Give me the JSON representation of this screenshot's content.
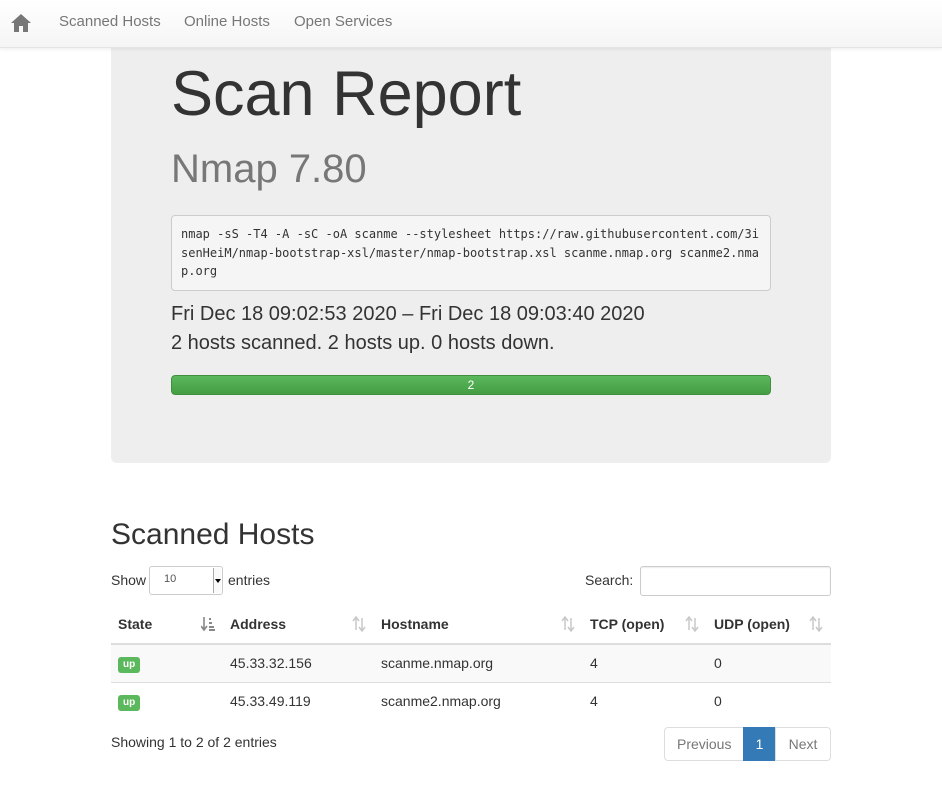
{
  "navbar": {
    "home_icon": "home-icon",
    "items": [
      {
        "label": "Scanned Hosts"
      },
      {
        "label": "Online Hosts"
      },
      {
        "label": "Open Services"
      }
    ]
  },
  "report": {
    "title": "Scan Report",
    "subtitle": "Nmap 7.80",
    "command": "nmap -sS -T4 -A -sC -oA scanme --stylesheet https://raw.githubusercontent.com/3isenHeiM/nmap-bootstrap-xsl/master/nmap-bootstrap.xsl scanme.nmap.org scanme2.nmap.org",
    "time_range": "Fri Dec 18 09:02:53 2020 – Fri Dec 18 09:03:40 2020",
    "summary": "2 hosts scanned. 2 hosts up. 0 hosts down.",
    "progress": {
      "label": "2",
      "fraction_up": 1.0,
      "color": "#5cb85c"
    }
  },
  "hosts_section": {
    "title": "Scanned Hosts",
    "show_label": "Show",
    "page_length": "10",
    "entries_label": "entries",
    "search_label": "Search:",
    "search_value": "",
    "columns": [
      "State",
      "Address",
      "Hostname",
      "TCP (open)",
      "UDP (open)"
    ],
    "rows": [
      {
        "state": "up",
        "address": "45.33.32.156",
        "hostname": "scanme.nmap.org",
        "tcp": "4",
        "udp": "0"
      },
      {
        "state": "up",
        "address": "45.33.49.119",
        "hostname": "scanme2.nmap.org",
        "tcp": "4",
        "udp": "0"
      }
    ],
    "info": "Showing 1 to 2 of 2 entries",
    "pagination": {
      "previous": "Previous",
      "current": "1",
      "next": "Next"
    }
  },
  "colors": {
    "accent_blue": "#337ab7",
    "success_green": "#5cb85c",
    "jumbotron_bg": "#eeeeee"
  }
}
